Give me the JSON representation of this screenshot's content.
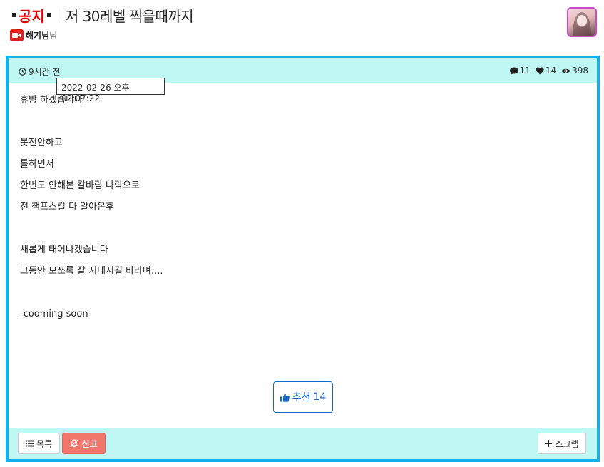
{
  "header": {
    "notice_label": "공지",
    "title": "저 30레벨 찍을때까지",
    "author_name": "해기님",
    "author_suffix": "님"
  },
  "meta": {
    "time_ago": "9시간 전",
    "tooltip_datetime": "2022-02-26 오후 02:07:22",
    "comments": "11",
    "likes": "14",
    "views": "398"
  },
  "content": {
    "lines": [
      "휴방 하겠습니다",
      "",
      "봇전안하고",
      "롤하면서",
      "한번도 안해본 칼바람 나락으로",
      "전 챔프스킬 다 알아온후",
      "",
      "새롭게 태어나겠습니다",
      "그동안 모쪼록 잘 지내시길 바라며....",
      "",
      "-cooming soon-"
    ]
  },
  "recommend": {
    "label": "추천",
    "count": "14"
  },
  "footer": {
    "list_label": "목록",
    "report_label": "신고",
    "scrap_label": "스크랩"
  },
  "colors": {
    "frame_border": "#13b0ee",
    "bar_bg": "#bff7f4",
    "notice_red": "#e60000",
    "recommend_blue": "#1a66c9",
    "report_bg": "#f0776a"
  }
}
